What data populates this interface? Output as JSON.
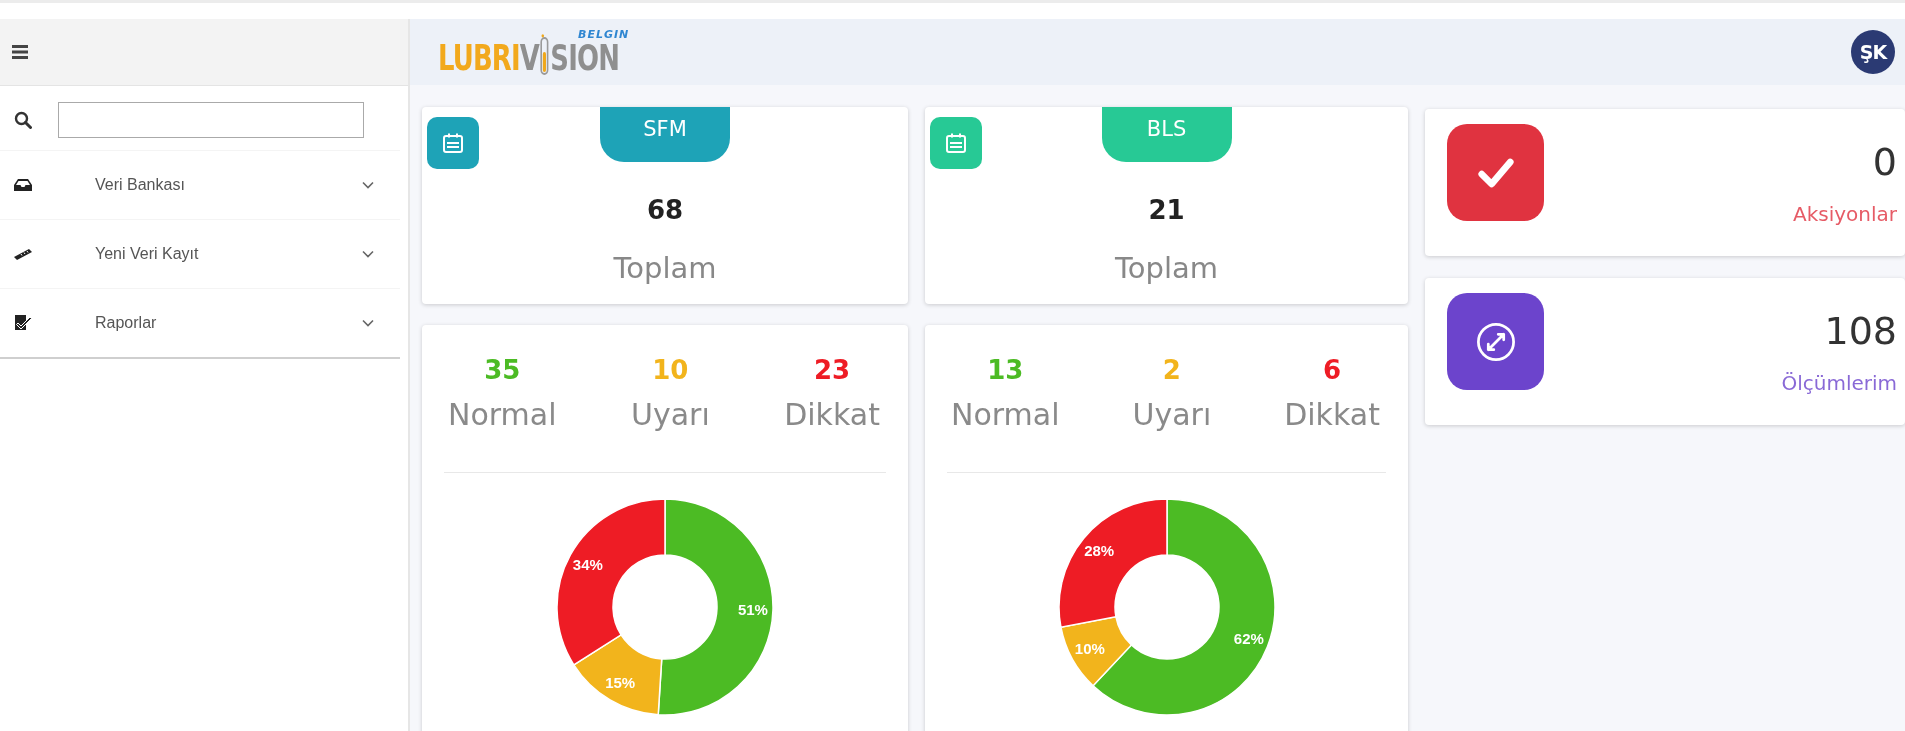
{
  "sidebar": {
    "items": [
      {
        "label": "Veri Bankası",
        "expanded": false
      },
      {
        "label": "Yeni Veri Kayıt",
        "expanded": false
      },
      {
        "label": "Raporlar",
        "expanded": false
      }
    ]
  },
  "header": {
    "logo": {
      "tagline": "BELGIN",
      "word_start": "LUBRI",
      "word_middle": "V",
      "word_end": "SION"
    },
    "avatar": "ŞK"
  },
  "summary_cards": [
    {
      "tab": "SFM",
      "color": "#1ea3b7",
      "value": "68",
      "label": "Toplam"
    },
    {
      "tab": "BLS",
      "color": "#27c995",
      "value": "21",
      "label": "Toplam"
    }
  ],
  "status_cards": [
    {
      "stats": [
        {
          "value": "35",
          "label": "Normal",
          "color": "#4cbb24"
        },
        {
          "value": "10",
          "label": "Uyarı",
          "color": "#f2b41c"
        },
        {
          "value": "23",
          "label": "Dikkat",
          "color": "#ee1c25"
        }
      ],
      "chart_data": {
        "type": "donut",
        "series": [
          {
            "values": [
              51,
              15,
              34
            ]
          }
        ],
        "value_labels": [
          "51%",
          "15%",
          "34%"
        ]
      }
    },
    {
      "stats": [
        {
          "value": "13",
          "label": "Normal",
          "color": "#4cbb24"
        },
        {
          "value": "2",
          "label": "Uyarı",
          "color": "#f2b41c"
        },
        {
          "value": "6",
          "label": "Dikkat",
          "color": "#ee1c25"
        }
      ],
      "chart_data": {
        "type": "donut",
        "series": [
          {
            "values": [
              62,
              10,
              28
            ]
          }
        ],
        "value_labels": [
          "62%",
          "10%",
          "28%"
        ]
      }
    }
  ],
  "kpi_cards": [
    {
      "value": "0",
      "label": "Aksiyonlar",
      "color": "#e03340"
    },
    {
      "value": "108",
      "label": "Ölçümlerim",
      "color": "#6c44cc"
    }
  ]
}
